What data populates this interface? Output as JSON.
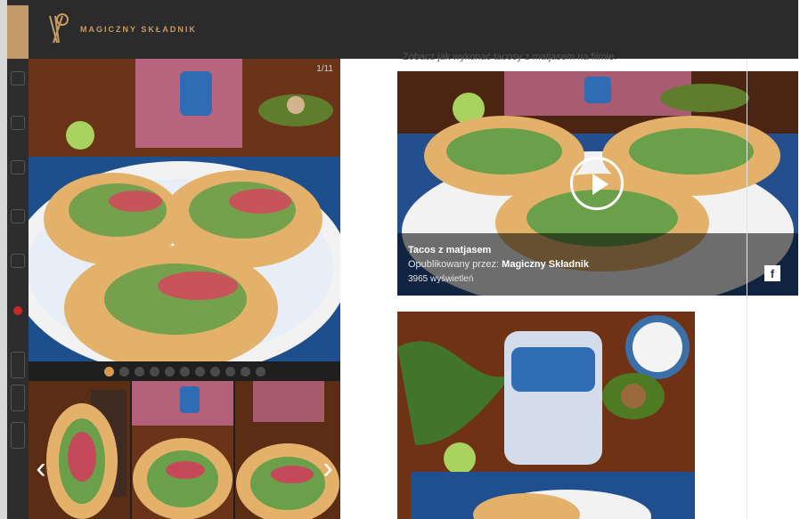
{
  "brand": {
    "name": "MAGICZNY SKŁADNIK"
  },
  "gallery": {
    "counter": "1/11",
    "dots": [
      true,
      false,
      false,
      false,
      false,
      false,
      false,
      false,
      false,
      false,
      false
    ]
  },
  "content": {
    "intro_text": "Zobacz jak wykonać tacosy z matjasem na filmie."
  },
  "video": {
    "title": "Tacos z matjasem",
    "published_prefix": "Opublikowany przez: ",
    "publisher": "Magiczny Składnik",
    "views": "3965 wyświetleń"
  },
  "icons": {
    "left_arrow": "‹",
    "right_arrow": "›",
    "fb_icon": "f"
  }
}
